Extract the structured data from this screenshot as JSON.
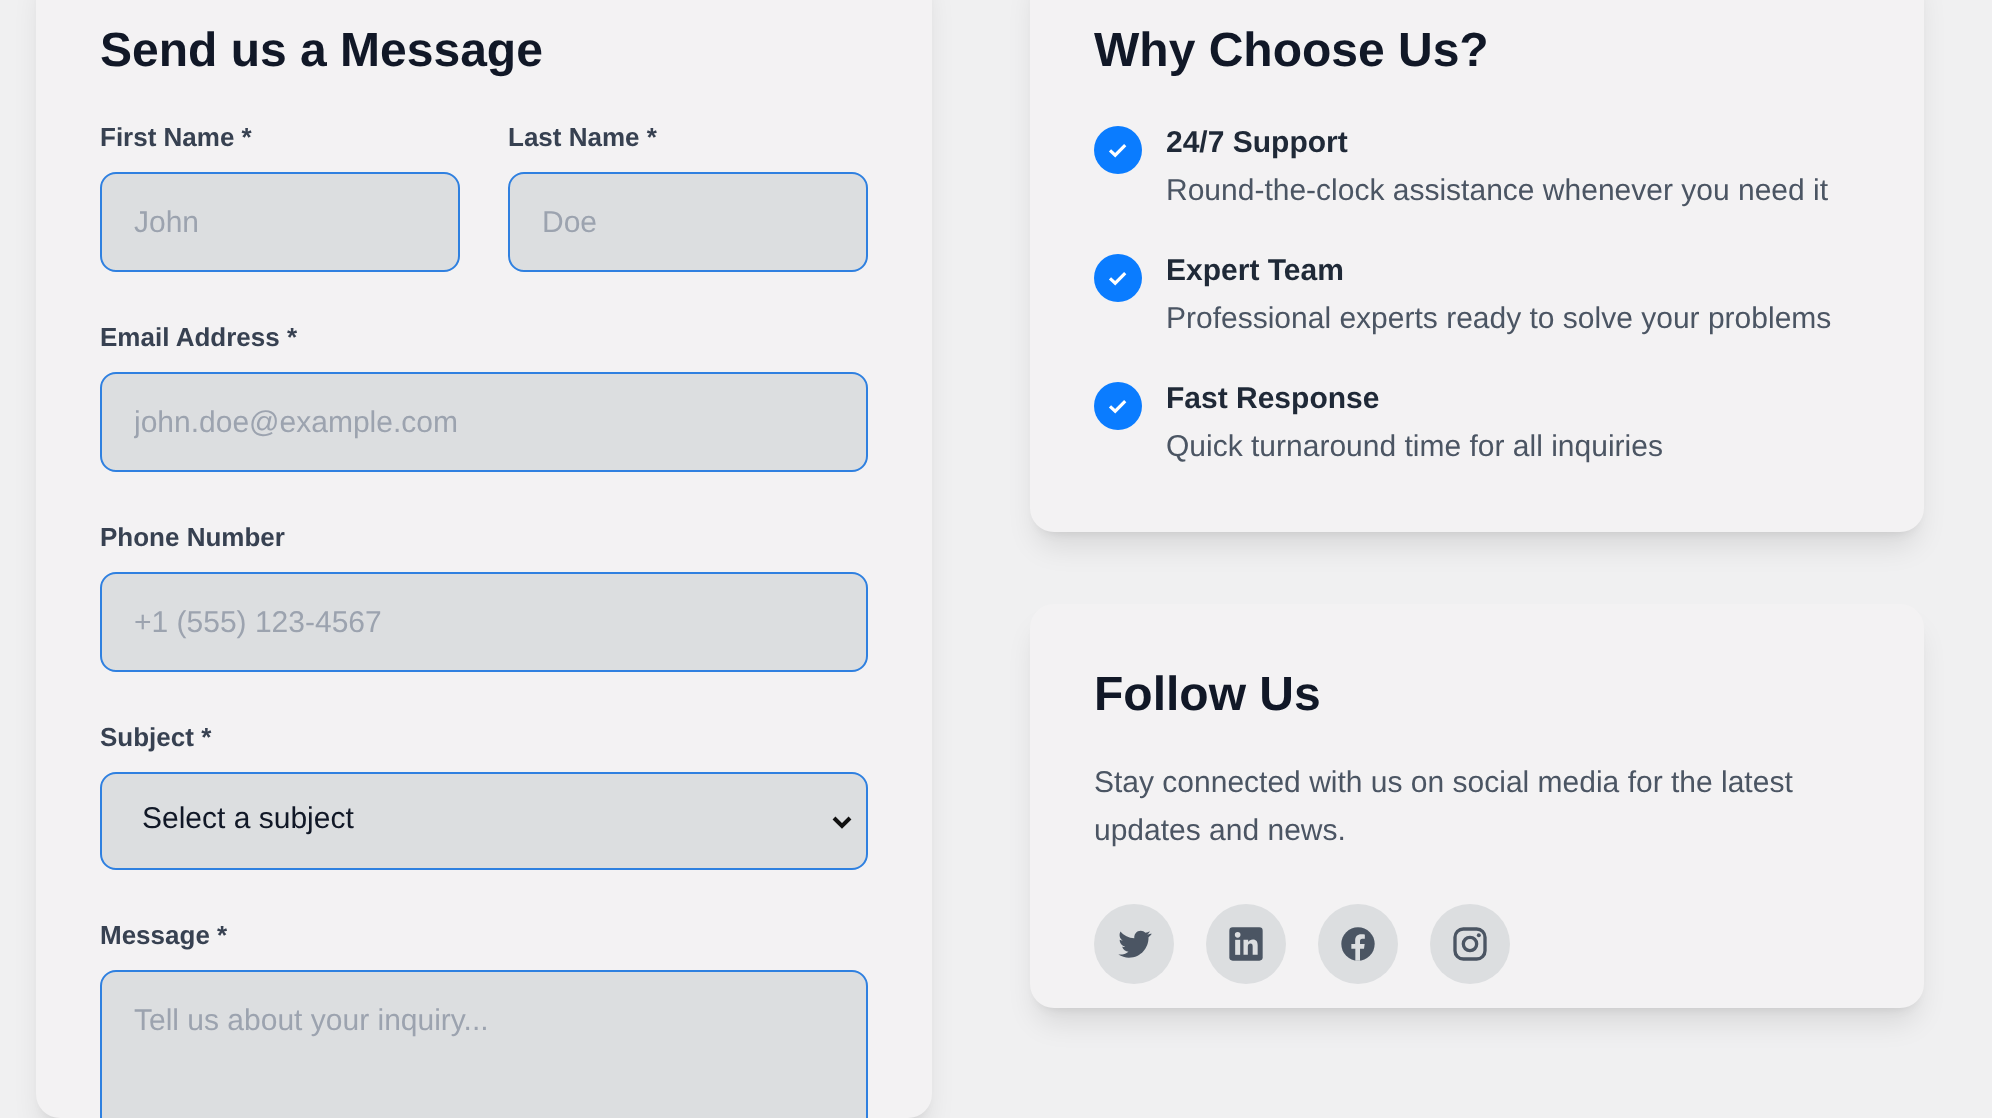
{
  "contact_form": {
    "title": "Send us a Message",
    "fields": [
      {
        "label": "First Name *",
        "placeholder": "John",
        "kind": "text"
      },
      {
        "label": "Last Name *",
        "placeholder": "Doe",
        "kind": "text"
      },
      {
        "label": "Email Address *",
        "placeholder": "john.doe@example.com",
        "kind": "text"
      },
      {
        "label": "Phone Number",
        "placeholder": "+1 (555) 123-4567",
        "kind": "text"
      },
      {
        "label": "Subject *",
        "value": "Select a subject",
        "kind": "select"
      },
      {
        "label": "Message *",
        "placeholder": "Tell us about your inquiry...",
        "kind": "textarea"
      }
    ]
  },
  "why_choose_us": {
    "title": "Why Choose Us?",
    "items": [
      {
        "title": "24/7 Support",
        "description": "Round-the-clock assistance whenever you need it"
      },
      {
        "title": "Expert Team",
        "description": "Professional experts ready to solve your problems"
      },
      {
        "title": "Fast Response",
        "description": "Quick turnaround time for all inquiries"
      }
    ]
  },
  "follow_us": {
    "title": "Follow Us",
    "description": "Stay connected with us on social media for the latest updates and news.",
    "social_links": [
      {
        "kind": "twitter"
      },
      {
        "kind": "linkedin"
      },
      {
        "kind": "facebook"
      },
      {
        "kind": "instagram"
      }
    ]
  }
}
